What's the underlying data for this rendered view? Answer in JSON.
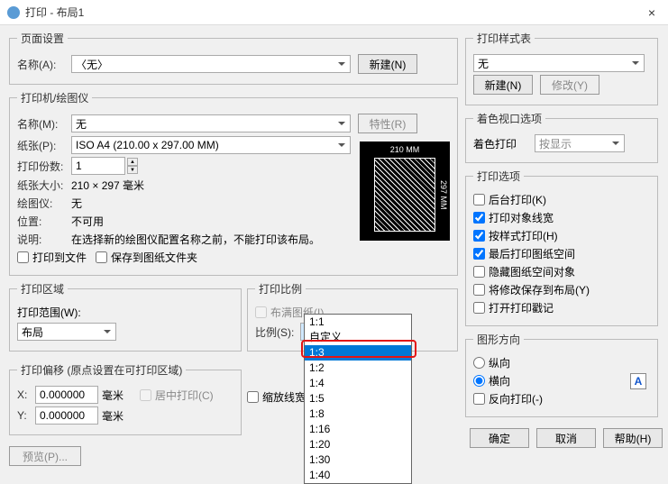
{
  "title": "打印 - 布局1",
  "page_setup": {
    "legend": "页面设置",
    "name_label": "名称(A):",
    "name_value": "〈无〉",
    "new_btn": "新建(N)"
  },
  "printer": {
    "legend": "打印机/绘图仪",
    "name_label": "名称(M):",
    "name_value": "无",
    "properties_btn": "特性(R)",
    "paper_label": "纸张(P):",
    "paper_value": "ISO A4 (210.00 x 297.00 MM)",
    "copies_label": "打印份数:",
    "copies_value": "1",
    "papersize_label": "纸张大小:",
    "papersize_value": "210 × 297 毫米",
    "plotter_label": "绘图仪:",
    "plotter_value": "无",
    "position_label": "位置:",
    "position_value": "不可用",
    "desc_label": "说明:",
    "desc_value": "在选择新的绘图仪配置名称之前，不能打印该布局。",
    "to_file": "打印到文件",
    "save_to_paper": "保存到图纸文件夹",
    "dim_top": "210 MM",
    "dim_right": "297 MM"
  },
  "print_area": {
    "legend": "打印区域",
    "range_label": "打印范围(W):",
    "range_value": "布局"
  },
  "scale": {
    "legend": "打印比例",
    "fit_paper": "布满图纸(I)",
    "ratio_label": "比例(S):",
    "ratio_value": "1:1",
    "options": [
      "1:1",
      "自定义",
      "1:3",
      "1:2",
      "1:4",
      "1:5",
      "1:8",
      "1:16",
      "1:20",
      "1:30",
      "1:40"
    ],
    "scale_lines": "缩放线宽"
  },
  "offset": {
    "legend": "打印偏移 (原点设置在可打印区域)",
    "x_label": "X:",
    "x_value": "0.000000",
    "y_label": "Y:",
    "y_value": "0.000000",
    "unit": "毫米",
    "center": "居中打印(C)"
  },
  "style_table": {
    "legend": "打印样式表",
    "value": "无",
    "new_btn": "新建(N)",
    "modify_btn": "修改(Y)"
  },
  "shade": {
    "legend": "着色视口选项",
    "label": "着色打印",
    "value": "按显示"
  },
  "print_opts": {
    "legend": "打印选项",
    "background": "后台打印(K)",
    "lineweight": "打印对象线宽",
    "by_style": "按样式打印(H)",
    "last_print_paperspace": "最后打印图纸空间",
    "hide_paperspace": "隐藏图纸空间对象",
    "save_changes": "将修改保存到布局(Y)",
    "open_stamp": "打开打印戳记"
  },
  "orientation": {
    "legend": "图形方向",
    "portrait": "纵向",
    "landscape": "横向",
    "reverse": "反向打印(-)"
  },
  "footer": {
    "preview": "预览(P)...",
    "ok": "确定",
    "cancel": "取消",
    "help": "帮助(H)"
  }
}
